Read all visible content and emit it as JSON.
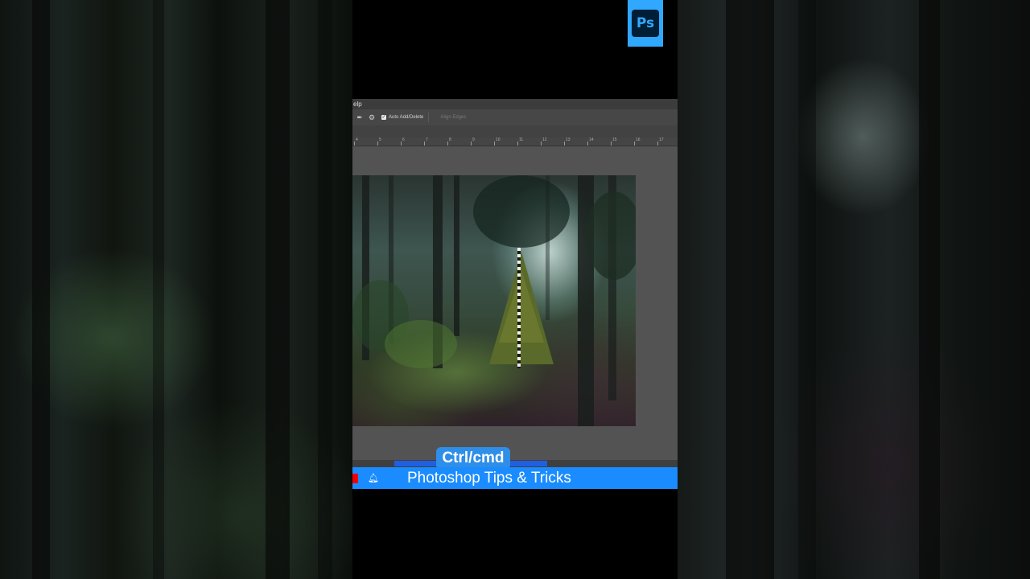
{
  "app": {
    "name": "Photoshop",
    "logo_text": "Ps",
    "accent": "#31a8ff"
  },
  "menubar": {
    "visible_text": "elp"
  },
  "options_bar": {
    "auto_add_delete": {
      "label": "Auto Add/Delete",
      "checked": true
    },
    "align_edges_label": "Align Edges"
  },
  "ruler": {
    "labels": [
      "4",
      "5",
      "6",
      "7",
      "8",
      "9",
      "10",
      "11",
      "12",
      "13",
      "14",
      "15",
      "16",
      "17"
    ]
  },
  "overlay": {
    "key_hint": "Ctrl/cmd"
  },
  "banner": {
    "title": "Photoshop Tips & Tricks",
    "color": "#1a8cff"
  }
}
